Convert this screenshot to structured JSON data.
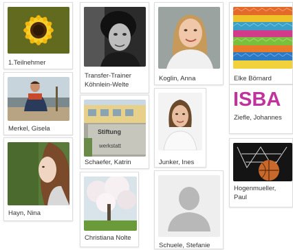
{
  "participants": [
    {
      "name": "1.Teilnehmer",
      "photo": "sunflower"
    },
    {
      "name": "Transfer-Trainer Köhnlein-Welte",
      "photo": "portrait-bw"
    },
    {
      "name": "Koglin, Anna",
      "photo": "portrait-woman"
    },
    {
      "name": "Elke Börnard",
      "photo": "knitted-wool"
    },
    {
      "name": "Merkel, Gisela",
      "photo": "man-on-beach"
    },
    {
      "name": "Schaefer, Katrin",
      "photo": "stiftung-sign",
      "photo_text": [
        "Stiftung",
        "werkstatt"
      ]
    },
    {
      "name": "Junker, Ines",
      "photo": "portrait-woman"
    },
    {
      "name": "Ziefle, Johannes",
      "photo": "isba-logo",
      "photo_text": [
        "ISBA"
      ]
    },
    {
      "name": "Hayn, Nina",
      "photo": "woman-profile"
    },
    {
      "name": "Christiana Nolte",
      "photo": "blossom-tree"
    },
    {
      "name": "Schuele, Stefanie",
      "photo": "default-avatar"
    },
    {
      "name": "Hogenmueller, Paul",
      "photo": "basketball-hoop"
    }
  ],
  "colors": {
    "isba_logo": "#c0339c",
    "card_border": "#dcdcdc",
    "name_text": "#333333"
  }
}
